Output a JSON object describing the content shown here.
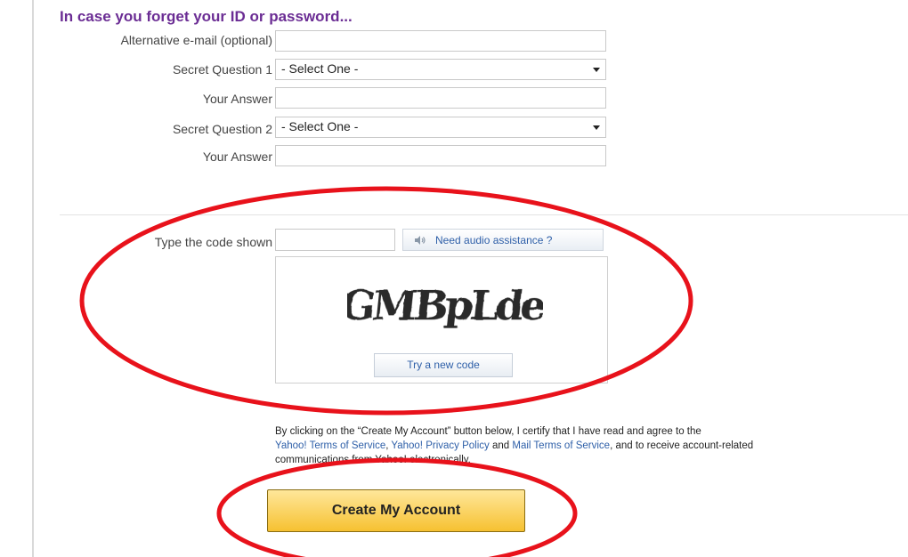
{
  "section": {
    "title": "In case you forget your ID or password..."
  },
  "fields": {
    "alt_email_label": "Alternative e-mail (optional)",
    "secret_q1_label": "Secret Question 1",
    "secret_q1_value": "- Select One -",
    "answer1_label": "Your Answer",
    "secret_q2_label": "Secret Question 2",
    "secret_q2_value": "- Select One -",
    "answer2_label": "Your Answer"
  },
  "captcha": {
    "label": "Type the code shown",
    "audio_button": "Need audio assistance ?",
    "image_text": "GMBpLde",
    "new_code_button": "Try a new code"
  },
  "terms": {
    "text_1": "By clicking on the “Create My Account” button below, I certify that I have read and agree to the",
    "link_tos": "Yahoo! Terms of Service",
    "sep_1": ", ",
    "link_privacy": "Yahoo! Privacy Policy",
    "sep_2": " and ",
    "link_mail_tos": "Mail Terms of Service",
    "text_2": ", and to receive account-related communications from Yahoo! electronically."
  },
  "actions": {
    "create_account": "Create My Account"
  },
  "colors": {
    "title_purple": "#6b2d94",
    "link_blue": "#2e5fa8",
    "button_gold": "#f6c131",
    "annotation_red": "#e8121b"
  }
}
